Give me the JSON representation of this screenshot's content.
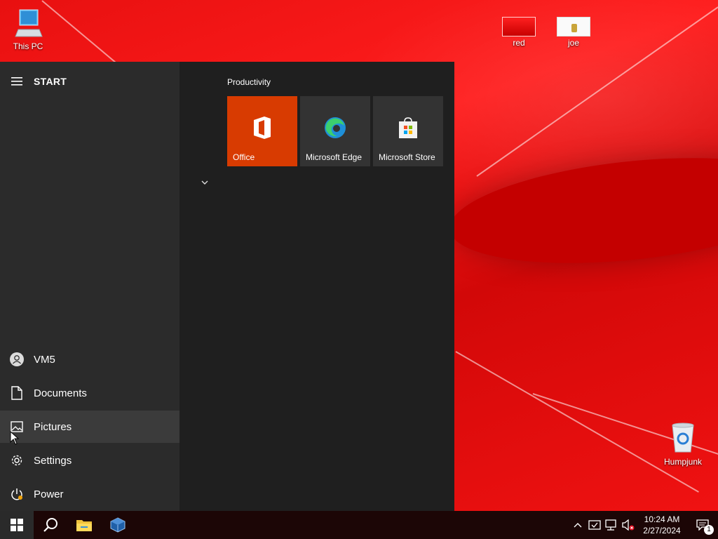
{
  "desktop": {
    "icons": [
      {
        "label": "This PC"
      },
      {
        "label": "red"
      },
      {
        "label": "joe"
      },
      {
        "label": "Humpjunk"
      }
    ]
  },
  "start_menu": {
    "title": "START",
    "left_items": [
      {
        "label": "VM5",
        "icon": "user-avatar-icon"
      },
      {
        "label": "Documents",
        "icon": "document-icon"
      },
      {
        "label": "Pictures",
        "icon": "pictures-icon",
        "hovered": true
      },
      {
        "label": "Settings",
        "icon": "gear-icon"
      },
      {
        "label": "Power",
        "icon": "power-icon"
      }
    ],
    "group": {
      "title": "Productivity",
      "tiles": [
        {
          "label": "Office",
          "color": "#d83b01",
          "icon": "office-icon"
        },
        {
          "label": "Microsoft Edge",
          "color": "#333333",
          "icon": "edge-icon"
        },
        {
          "label": "Microsoft Store",
          "color": "#333333",
          "icon": "store-icon"
        }
      ]
    }
  },
  "taskbar": {
    "items": [
      "windows-start-icon",
      "search-icon",
      "file-explorer-icon",
      "virtualbox-icon"
    ],
    "tray_icons": [
      "chevron-up-icon",
      "security-icon",
      "network-icon",
      "volume-muted-icon"
    ],
    "time": "10:24 AM",
    "date": "2/27/2024",
    "notification_count": "1"
  }
}
